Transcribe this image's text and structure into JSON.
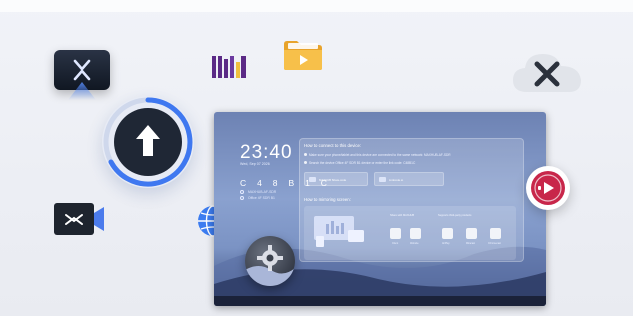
{
  "device": {
    "time": "23:40",
    "date": "Wed, Sep 07 2026",
    "code": "C 4 8 B 1 C",
    "info_lines": [
      "MAXHUB-AF-SDR",
      "Office 4F SDR B1"
    ]
  },
  "panel": {
    "connect_title": "How to connect to this device:",
    "steps": [
      "Make sure your phone/tablet and this device are connected to the same network: MAXHUB-AF-SDR",
      "Search the device Office 4F SDR B1 device or enter the link code: C48B1C"
    ],
    "chips": [
      "MAXHUB Share-code",
      "Linkcode.io"
    ],
    "mirror_title": "How to mirroring screen:",
    "mirror_cols": [
      {
        "title": "Share with MAXHUB",
        "items": [
          "Client",
          "Website"
        ]
      },
      {
        "title": "Supports third-party products",
        "items": [
          "AirPlay",
          "Miracast",
          "Chromecast"
        ]
      }
    ]
  },
  "icons": {
    "app_tile": "maxhub-app-icon",
    "upload": "upload-icon",
    "logo": "brand-logo-icon",
    "folder": "video-folder-icon",
    "cloud": "cloud-icon",
    "video": "video-camera-icon",
    "globe": "globe-icon",
    "cast": "cast-icon",
    "gear": "gear-icon"
  },
  "colors": {
    "accent_blue": "#4b7bec",
    "cast_red": "#c8264a",
    "folder_yellow": "#f5b53c",
    "logo_purple": "#5b2a86"
  }
}
